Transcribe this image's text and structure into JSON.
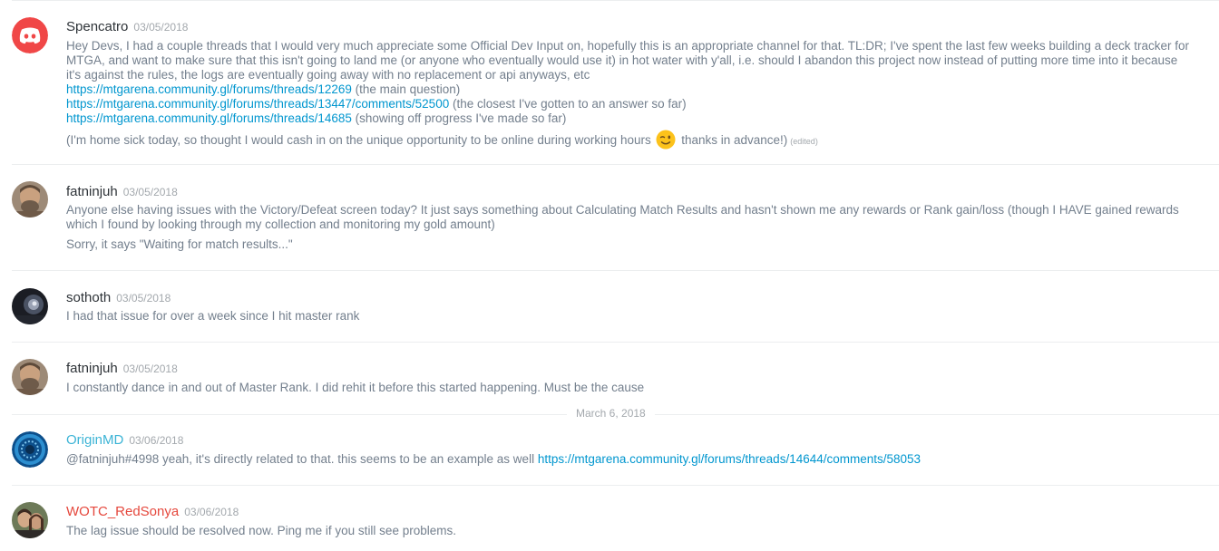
{
  "colors": {
    "text": "#737f8d",
    "username_default": "#2e3338",
    "username_originmd": "#3cb4d6",
    "username_wotc": "#e5483d",
    "link": "#0096cf",
    "timestamp": "#a3a8ad",
    "discord_brand": "#f04747"
  },
  "messages": [
    {
      "author": "Spencatro",
      "avatar_icon": "discord-logo-icon",
      "timestamp": "03/05/2018",
      "text_line1": "Hey Devs, I had a couple threads that I would very much appreciate some Official Dev Input on, hopefully this is an appropriate channel for that. TL:DR; I've spent the last few weeks building a deck tracker for MTGA, and want to make sure that this isn't going to land me (or anyone who eventually would use it) in hot water with y'all, i.e. should I abandon this project now instead of putting more time into it because it's against the rules, the logs are eventually going away with no replacement or api anyways, etc",
      "links": [
        {
          "url": "https://mtgarena.community.gl/forums/threads/12269",
          "note": " (the main question)"
        },
        {
          "url": "https://mtgarena.community.gl/forums/threads/13447/comments/52500",
          "note": " (the closest I've gotten to an answer so far)"
        },
        {
          "url": "https://mtgarena.community.gl/forums/threads/14685",
          "note": " (showing off progress I've made so far)"
        }
      ],
      "final_before": "(I'm home sick today, so thought I would cash in on the unique opportunity to be online during working hours ",
      "emoji": "winking-face-emoji",
      "final_after": " thanks in advance!)",
      "edited_label": "(edited)"
    },
    {
      "author": "fatninjuh",
      "avatar_icon": "user-photo-avatar",
      "timestamp": "03/05/2018",
      "text_line1": "Anyone else having issues with the Victory/Defeat screen today? It just says something about Calculating Match Results and hasn't shown me any rewards or Rank gain/loss (though I HAVE gained rewards which I found by looking through my collection and monitoring my gold amount)",
      "text_line2": "Sorry, it says \"Waiting for match results...\""
    },
    {
      "author": "sothoth",
      "avatar_icon": "user-photo-avatar",
      "timestamp": "03/05/2018",
      "text_line1": "I had that issue for over a week since I hit master rank"
    },
    {
      "author": "fatninjuh",
      "avatar_icon": "user-photo-avatar",
      "timestamp": "03/05/2018",
      "text_line1": "I constantly dance in and out of Master Rank. I did rehit it before this started happening. Must be the cause"
    },
    {
      "author": "OriginMD",
      "avatar_icon": "blue-ring-avatar",
      "timestamp": "03/06/2018",
      "text_before": "@fatninjuh#4998 yeah, it's directly related to that. this seems to be an example as well ",
      "link": "https://mtgarena.community.gl/forums/threads/14644/comments/58053"
    },
    {
      "author": "WOTC_RedSonya",
      "avatar_icon": "user-photo-avatar",
      "timestamp": "03/06/2018",
      "text_line1": "The lag issue should be resolved now. Ping me if you still see problems."
    }
  ],
  "date_separator": "March 6, 2018"
}
